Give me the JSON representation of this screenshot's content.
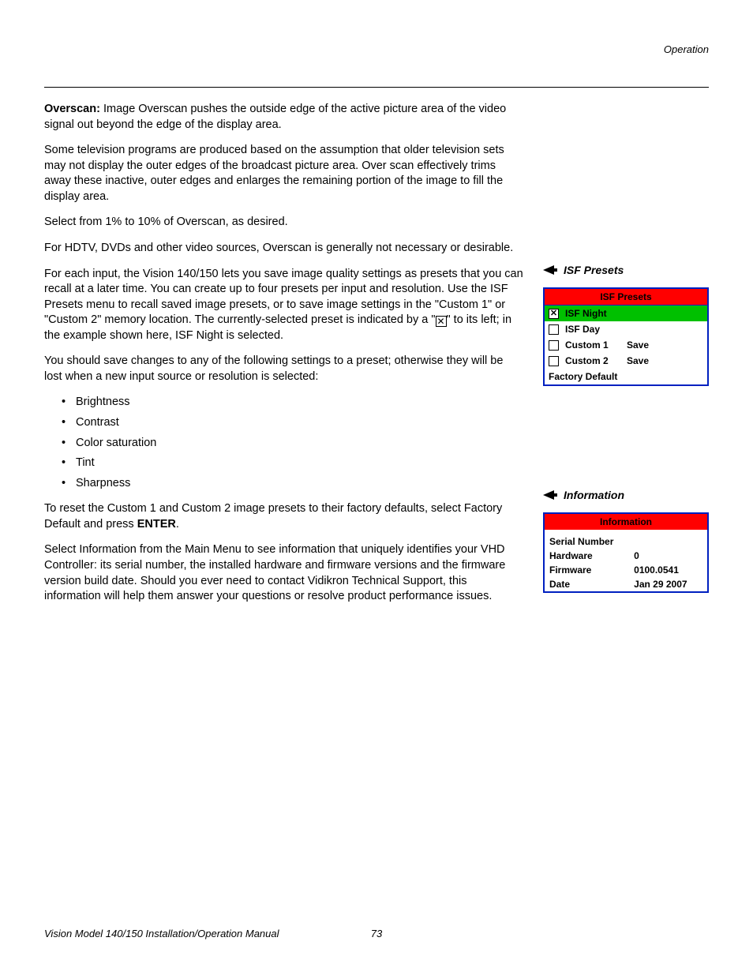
{
  "header": {
    "section": "Operation"
  },
  "overscan": {
    "lead": "Overscan:",
    "p1": " Image Overscan pushes the outside edge of the active picture area of the video signal out beyond the edge of the display area.",
    "p2": "Some television programs are produced based on the assumption that older television sets may not display the outer edges of the broadcast picture area. Over scan effectively trims away these inactive, outer edges and enlarges the remaining portion of the image to fill the display area.",
    "p3": "Select from 1% to 10% of Overscan, as desired.",
    "p4": "For HDTV, DVDs and other video sources, Overscan is generally not necessary or desirable."
  },
  "isf": {
    "p1a": "For each input, the Vision 140/150 lets you save image quality settings as presets that you can recall at a later time. You can create up to four presets per input and resolution. Use the ISF Presets menu to recall saved image presets, or to save image settings in the \"Custom 1\" or \"Custom 2\" memory location. The currently-selected preset is indicated by a \"",
    "p1b": "\" to its left; in the example shown here, ISF Night is selected.",
    "p2": "You should save changes to any of the following settings to a preset; otherwise they will be lost when a new input source or resolution is selected:",
    "bullets": [
      "Brightness",
      "Contrast",
      "Color saturation",
      "Tint",
      "Sharpness"
    ],
    "p3a": "To reset the Custom 1 and Custom 2 image presets to their factory defaults, select Factory Default and press ",
    "p3b": "ENTER",
    "p3c": "."
  },
  "info": {
    "p1": "Select Information from the Main Menu to see information that uniquely identifies your VHD Controller: its serial number, the installed hardware and firmware versions and the firmware version build date. Should you ever need to contact Vidikron Technical Support, this information will help them answer your questions or resolve product performance issues."
  },
  "sidebar": {
    "isf_heading": "ISF Presets",
    "isf_menu": {
      "title": "ISF Presets",
      "rows": [
        {
          "checked": true,
          "label": "ISF Night",
          "save": "",
          "selected": true
        },
        {
          "checked": false,
          "label": "ISF Day",
          "save": "",
          "selected": false
        },
        {
          "checked": false,
          "label": "Custom 1",
          "save": "Save",
          "selected": false
        },
        {
          "checked": false,
          "label": "Custom 2",
          "save": "Save",
          "selected": false
        }
      ],
      "footer": "Factory Default"
    },
    "info_heading": "Information",
    "info_menu": {
      "title": "Information",
      "rows": [
        {
          "label": "Serial Number",
          "value": ""
        },
        {
          "label": "Hardware",
          "value": "0"
        },
        {
          "label": "Firmware",
          "value": "0100.0541"
        },
        {
          "label": "Date",
          "value": "Jan 29 2007"
        }
      ]
    }
  },
  "footer": {
    "title": "Vision Model 140/150 Installation/Operation Manual",
    "page": "73"
  }
}
